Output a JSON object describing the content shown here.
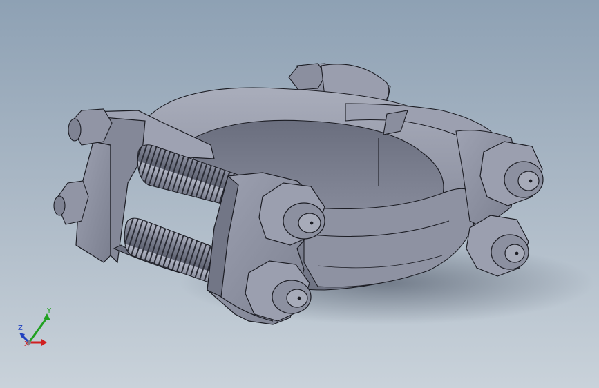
{
  "viewport": {
    "background_top": "#8ea1b4",
    "background_bottom": "#c9d2da",
    "part_color": "#8f93a3",
    "edge_color": "#1c1d24"
  },
  "triad": {
    "x_label": "X",
    "y_label": "Y",
    "z_label": "Z",
    "x_color": "#d02020",
    "y_color": "#20a020",
    "z_color": "#2040c0"
  }
}
